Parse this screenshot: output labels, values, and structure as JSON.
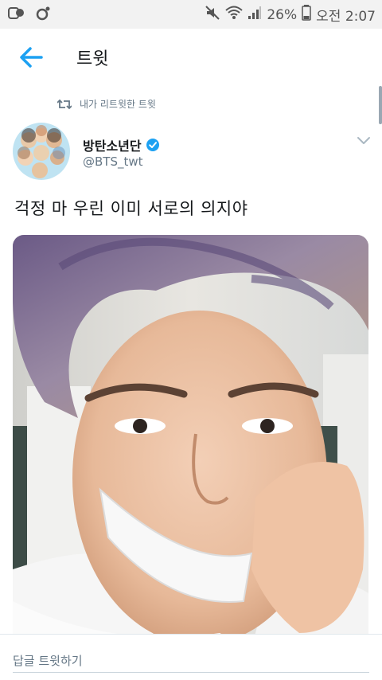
{
  "status_bar": {
    "battery": "26%",
    "time": "오전 2:07",
    "icons": [
      "app-notification-icon",
      "camera-icon",
      "mute-icon",
      "wifi-icon",
      "signal-icon",
      "battery-icon"
    ]
  },
  "header": {
    "title": "트윗",
    "back_icon": "arrow-left-icon"
  },
  "tweet": {
    "retweet_label": "내가 리트윗한 트윗",
    "display_name": "방탄소년단",
    "handle": "@BTS_twt",
    "verified": true,
    "text": "걱정 마 우린 이미 서로의 의지야"
  },
  "reply": {
    "placeholder": "답글 트윗하기"
  },
  "colors": {
    "accent": "#1da1f2",
    "text_primary": "#14171a",
    "text_secondary": "#657786",
    "status_bar_bg": "#f2f2f2"
  }
}
